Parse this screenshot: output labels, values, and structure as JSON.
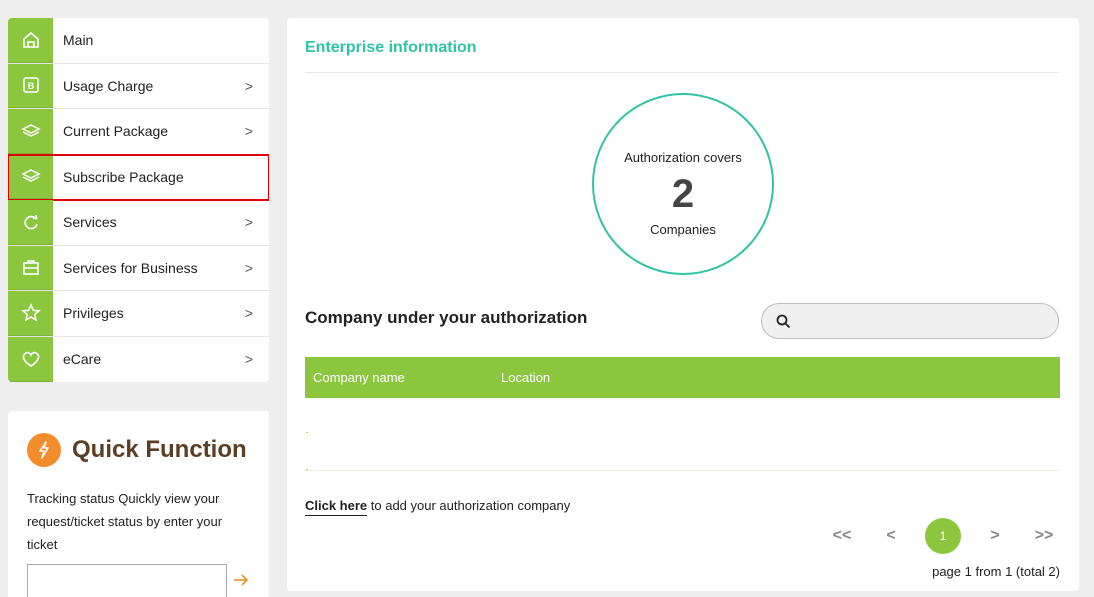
{
  "sidebar": {
    "items": [
      {
        "label": "Main",
        "icon": "home-icon",
        "chevron": ""
      },
      {
        "label": "Usage Charge",
        "icon": "bill-icon",
        "chevron": ">"
      },
      {
        "label": "Current Package",
        "icon": "layers-icon",
        "chevron": ">"
      },
      {
        "label": "Subscribe Package",
        "icon": "layers-icon",
        "chevron": "",
        "highlighted": true
      },
      {
        "label": "Services",
        "icon": "refresh-icon",
        "chevron": ">"
      },
      {
        "label": "Services for Business",
        "icon": "briefcase-icon",
        "chevron": ">"
      },
      {
        "label": "Privileges",
        "icon": "star-icon",
        "chevron": ">"
      },
      {
        "label": "eCare",
        "icon": "heart-icon",
        "chevron": ">"
      }
    ]
  },
  "quick_function": {
    "title": "Quick Function",
    "description": "Tracking status Quickly view your request/ticket status by enter your ticket",
    "input_value": "",
    "go_icon": "arrow-right-icon"
  },
  "main": {
    "title": "Enterprise information",
    "authorization": {
      "top_text": "Authorization covers",
      "count": "2",
      "bottom_text": "Companies"
    },
    "section_title": "Company under your authorization",
    "search": {
      "placeholder": "",
      "icon": "search-icon"
    },
    "table": {
      "columns": [
        "Company name",
        "Location"
      ],
      "rows": []
    },
    "add": {
      "link_text": "Click here",
      "rest_text": " to add your authorization company"
    },
    "pagination": {
      "first": "<<",
      "prev": "<",
      "current": "1",
      "next": ">",
      "last": ">>",
      "info": "page 1 from 1 (total 2)"
    }
  },
  "colors": {
    "accent_green": "#8cc63f",
    "teal": "#2ec4a5",
    "orange": "#f28d2c",
    "highlight_red": "#e00000"
  }
}
